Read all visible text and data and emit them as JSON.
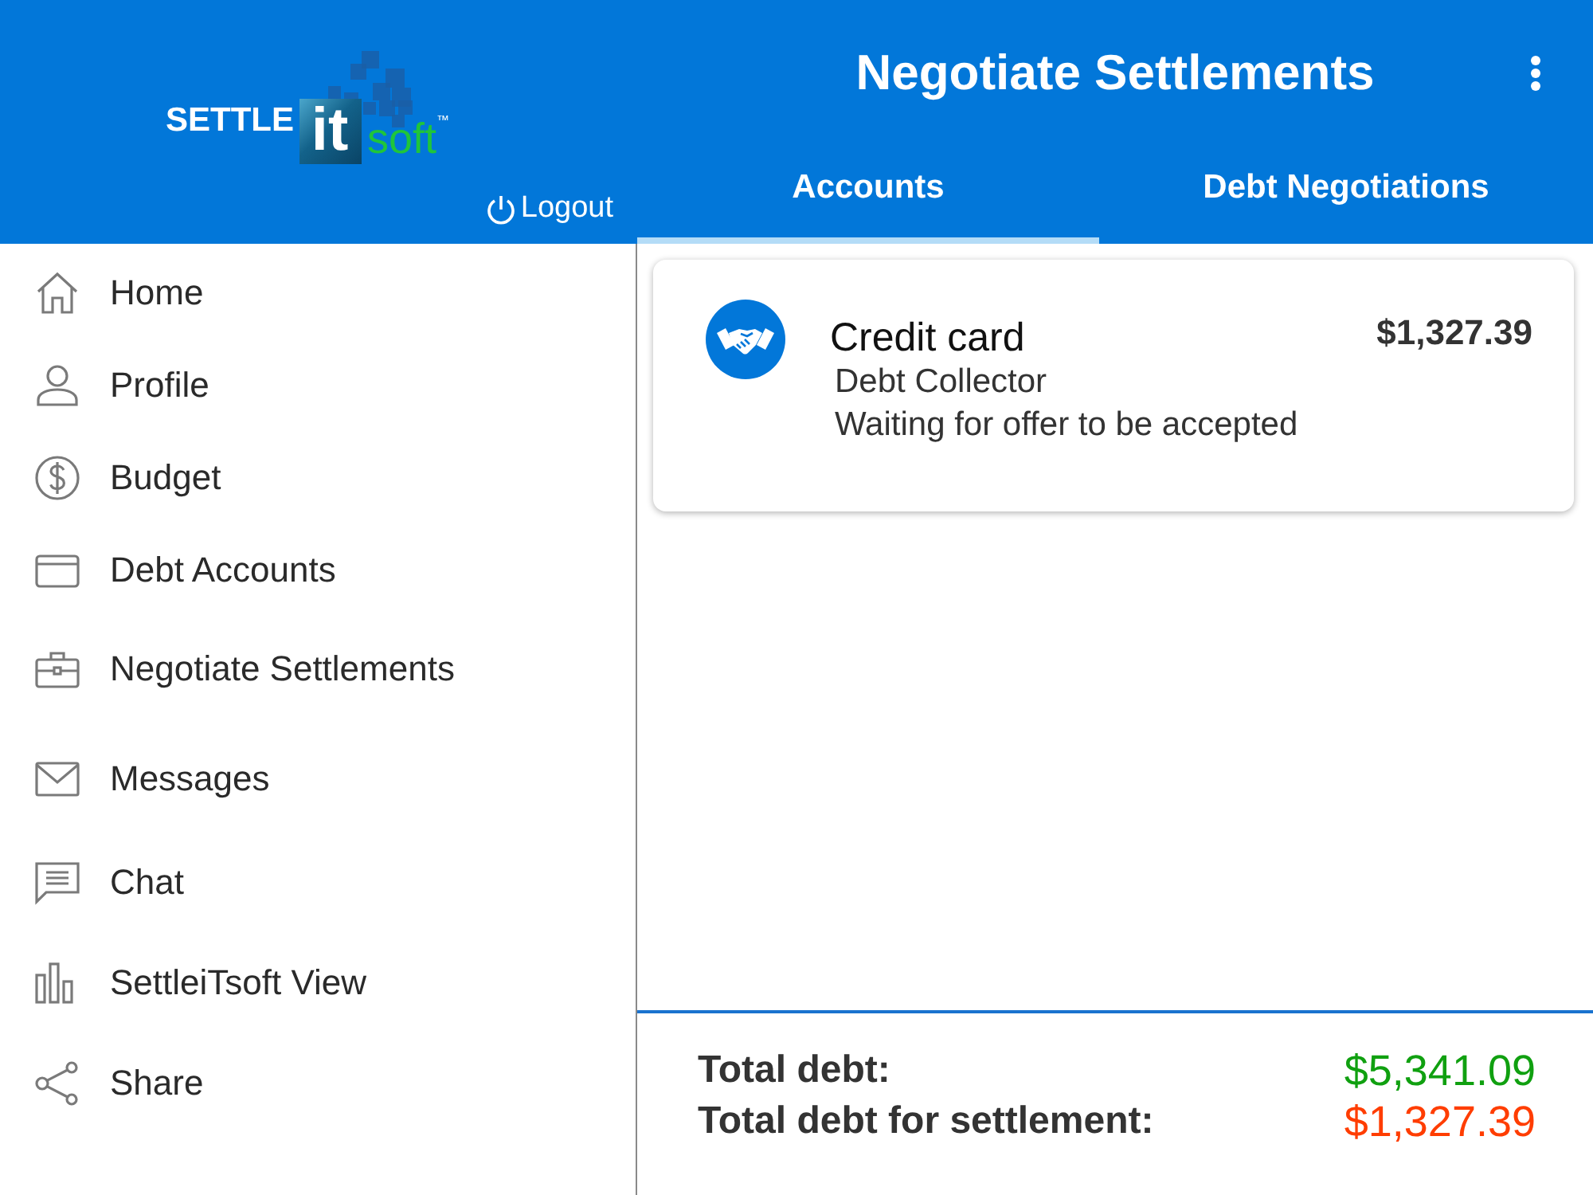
{
  "logo": {
    "word": "SETTLE",
    "block": "it",
    "suffix": "soft",
    "trademark": "™"
  },
  "logout": {
    "label": "Logout"
  },
  "app_bar": {
    "title": "Negotiate Settlements"
  },
  "tabs": [
    {
      "label": "Accounts",
      "selected": true
    },
    {
      "label": "Debt Negotiations",
      "selected": false
    }
  ],
  "sidebar": {
    "items": [
      {
        "label": "Home"
      },
      {
        "label": "Profile"
      },
      {
        "label": "Budget"
      },
      {
        "label": "Debt Accounts"
      },
      {
        "label": "Negotiate Settlements"
      },
      {
        "label": "Messages"
      },
      {
        "label": "Chat"
      },
      {
        "label": "SettleiTsoft View"
      },
      {
        "label": "Share"
      }
    ]
  },
  "accounts": [
    {
      "name": "Credit card",
      "creditor": "Debt Collector",
      "status": "Waiting for offer to be accepted",
      "amount": "$1,327.39"
    }
  ],
  "totals": [
    {
      "label": "Total debt:",
      "value": "$5,341.09",
      "color": "#10a010"
    },
    {
      "label": "Total debt for settlement:",
      "value": "$1,327.39",
      "color": "#ff3d00"
    }
  ]
}
